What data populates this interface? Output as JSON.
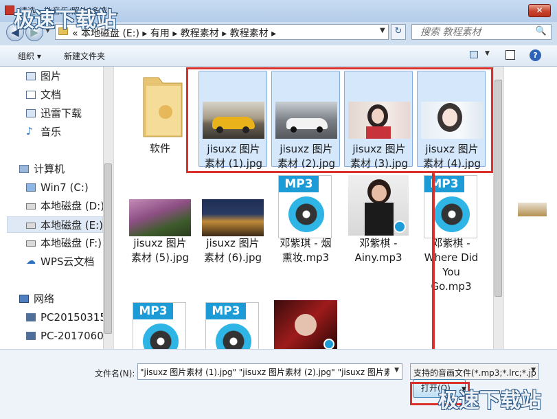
{
  "window": {
    "title": "请选一批音乐/照片(多选)...",
    "close_label": "✕"
  },
  "address": {
    "back_glyph": "◀",
    "forward_glyph": "▶",
    "path_text": "« 本地磁盘 (E:)  ▸  有用  ▸  教程素材  ▸  教程素材  ▸",
    "refresh_glyph": "↻",
    "search_placeholder": "搜索 教程素材",
    "search_glyph": "🔍"
  },
  "toolbar": {
    "organize_label": "组织 ▾",
    "new_folder_label": "新建文件夹",
    "help_glyph": "?"
  },
  "nav": {
    "favorites": [
      {
        "label": "图片",
        "icon": "pictures-icon"
      },
      {
        "label": "文档",
        "icon": "documents-icon"
      },
      {
        "label": "迅雷下载",
        "icon": "download-folder-icon"
      },
      {
        "label": "音乐",
        "icon": "music-icon"
      }
    ],
    "computer_label": "计算机",
    "drives": [
      {
        "label": "Win7 (C:)",
        "icon": "windows-drive-icon"
      },
      {
        "label": "本地磁盘 (D:)",
        "icon": "drive-icon"
      },
      {
        "label": "本地磁盘 (E:)",
        "icon": "drive-icon"
      },
      {
        "label": "本地磁盘 (F:)",
        "icon": "drive-icon"
      },
      {
        "label": "WPS云文档",
        "icon": "cloud-icon"
      }
    ],
    "network_label": "网络",
    "network_items": [
      {
        "label": "PC20150315"
      },
      {
        "label": "PC-2017060"
      }
    ]
  },
  "files": [
    {
      "line1": "软件",
      "line2": "",
      "type": "folder",
      "selected": false
    },
    {
      "line1": "jisuxz 图片",
      "line2": "素材 (1).jpg",
      "type": "image",
      "selected": true
    },
    {
      "line1": "jisuxz 图片",
      "line2": "素材 (2).jpg",
      "type": "image",
      "selected": true
    },
    {
      "line1": "jisuxz 图片",
      "line2": "素材 (3).jpg",
      "type": "image",
      "selected": true
    },
    {
      "line1": "jisuxz 图片",
      "line2": "素材 (4).jpg",
      "type": "image",
      "selected": true
    },
    {
      "line1": "jisuxz 图片",
      "line2": "素材 (5).jpg",
      "type": "image",
      "selected": false
    },
    {
      "line1": "jisuxz 图片",
      "line2": "素材 (6).jpg",
      "type": "image",
      "selected": false
    },
    {
      "line1": "邓紫琪 - 烟",
      "line2": "熏妆.mp3",
      "type": "mp3",
      "selected": false
    },
    {
      "line1": "邓紫棋 -",
      "line2": "Ainy.mp3",
      "type": "mp3",
      "selected": false
    },
    {
      "line1": "邓紫棋 -",
      "line2": "Where Did",
      "line3": "You",
      "line4": "Go.mp3",
      "type": "mp3",
      "selected": false
    }
  ],
  "mp3_badge": "MP3",
  "bottom": {
    "filename_label": "文件名(N):",
    "filename_value": "\"jisuxz 图片素材 (1).jpg\" \"jisuxz 图片素材 (2).jpg\" \"jisuxz 图片素材",
    "filetype_value": "支持的音画文件(*.mp3;*.lrc;*.jp",
    "open_label": "打开(O)"
  },
  "watermark": "极速下载站",
  "colors": {
    "highlight": "#d9322d",
    "selection": "#d5e7fa",
    "mp3_badge": "#1d9bd6"
  }
}
